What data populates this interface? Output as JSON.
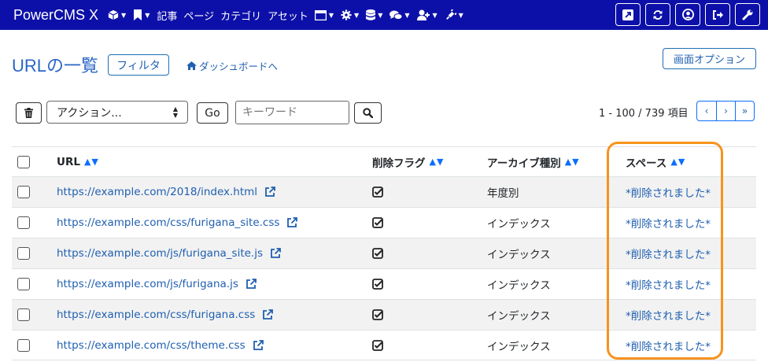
{
  "navbar": {
    "brand": "PowerCMS X",
    "text_items": [
      "記事",
      "ページ",
      "カテゴリ",
      "アセット"
    ],
    "icons_left_a": [
      "cube-icon",
      "bookmark-icon"
    ],
    "icons_left_b": [
      "window-icon",
      "gear-icon",
      "database-icon",
      "comments-icon",
      "user-plus-icon",
      "plug-icon"
    ],
    "icons_right": [
      "external-square-icon",
      "sync-icon",
      "user-circle-icon",
      "sign-out-icon",
      "wrench-icon"
    ]
  },
  "header": {
    "title": "URLの一覧",
    "filter_label": "フィルタ",
    "dashboard_link": "ダッシュボードへ",
    "screen_options_label": "画面オプション"
  },
  "toolbar": {
    "action_select_value": "アクション...",
    "go_label": "Go",
    "keyword_placeholder": "キーワード",
    "page_info": "1 - 100 / 739 項目"
  },
  "pager": {
    "prev": "‹",
    "next": "›",
    "last": "»"
  },
  "table": {
    "columns": {
      "url": "URL",
      "delete_flag": "削除フラグ",
      "archive_type": "アーカイブ種別",
      "space": "スペース"
    },
    "sort_arrows": "▲▼",
    "rows": [
      {
        "url": "https://example.com/2018/index.html",
        "archive_type": "年度別",
        "space": "*削除されました*"
      },
      {
        "url": "https://example.com/css/furigana_site.css",
        "archive_type": "インデックス",
        "space": "*削除されました*"
      },
      {
        "url": "https://example.com/js/furigana_site.js",
        "archive_type": "インデックス",
        "space": "*削除されました*"
      },
      {
        "url": "https://example.com/js/furigana.js",
        "archive_type": "インデックス",
        "space": "*削除されました*"
      },
      {
        "url": "https://example.com/css/furigana.css",
        "archive_type": "インデックス",
        "space": "*削除されました*"
      },
      {
        "url": "https://example.com/css/theme.css",
        "archive_type": "インデックス",
        "space": "*削除されました*"
      }
    ]
  },
  "colors": {
    "navbar": "#0d10a8",
    "link": "#1f5fb0",
    "highlight": "#f7931e"
  }
}
